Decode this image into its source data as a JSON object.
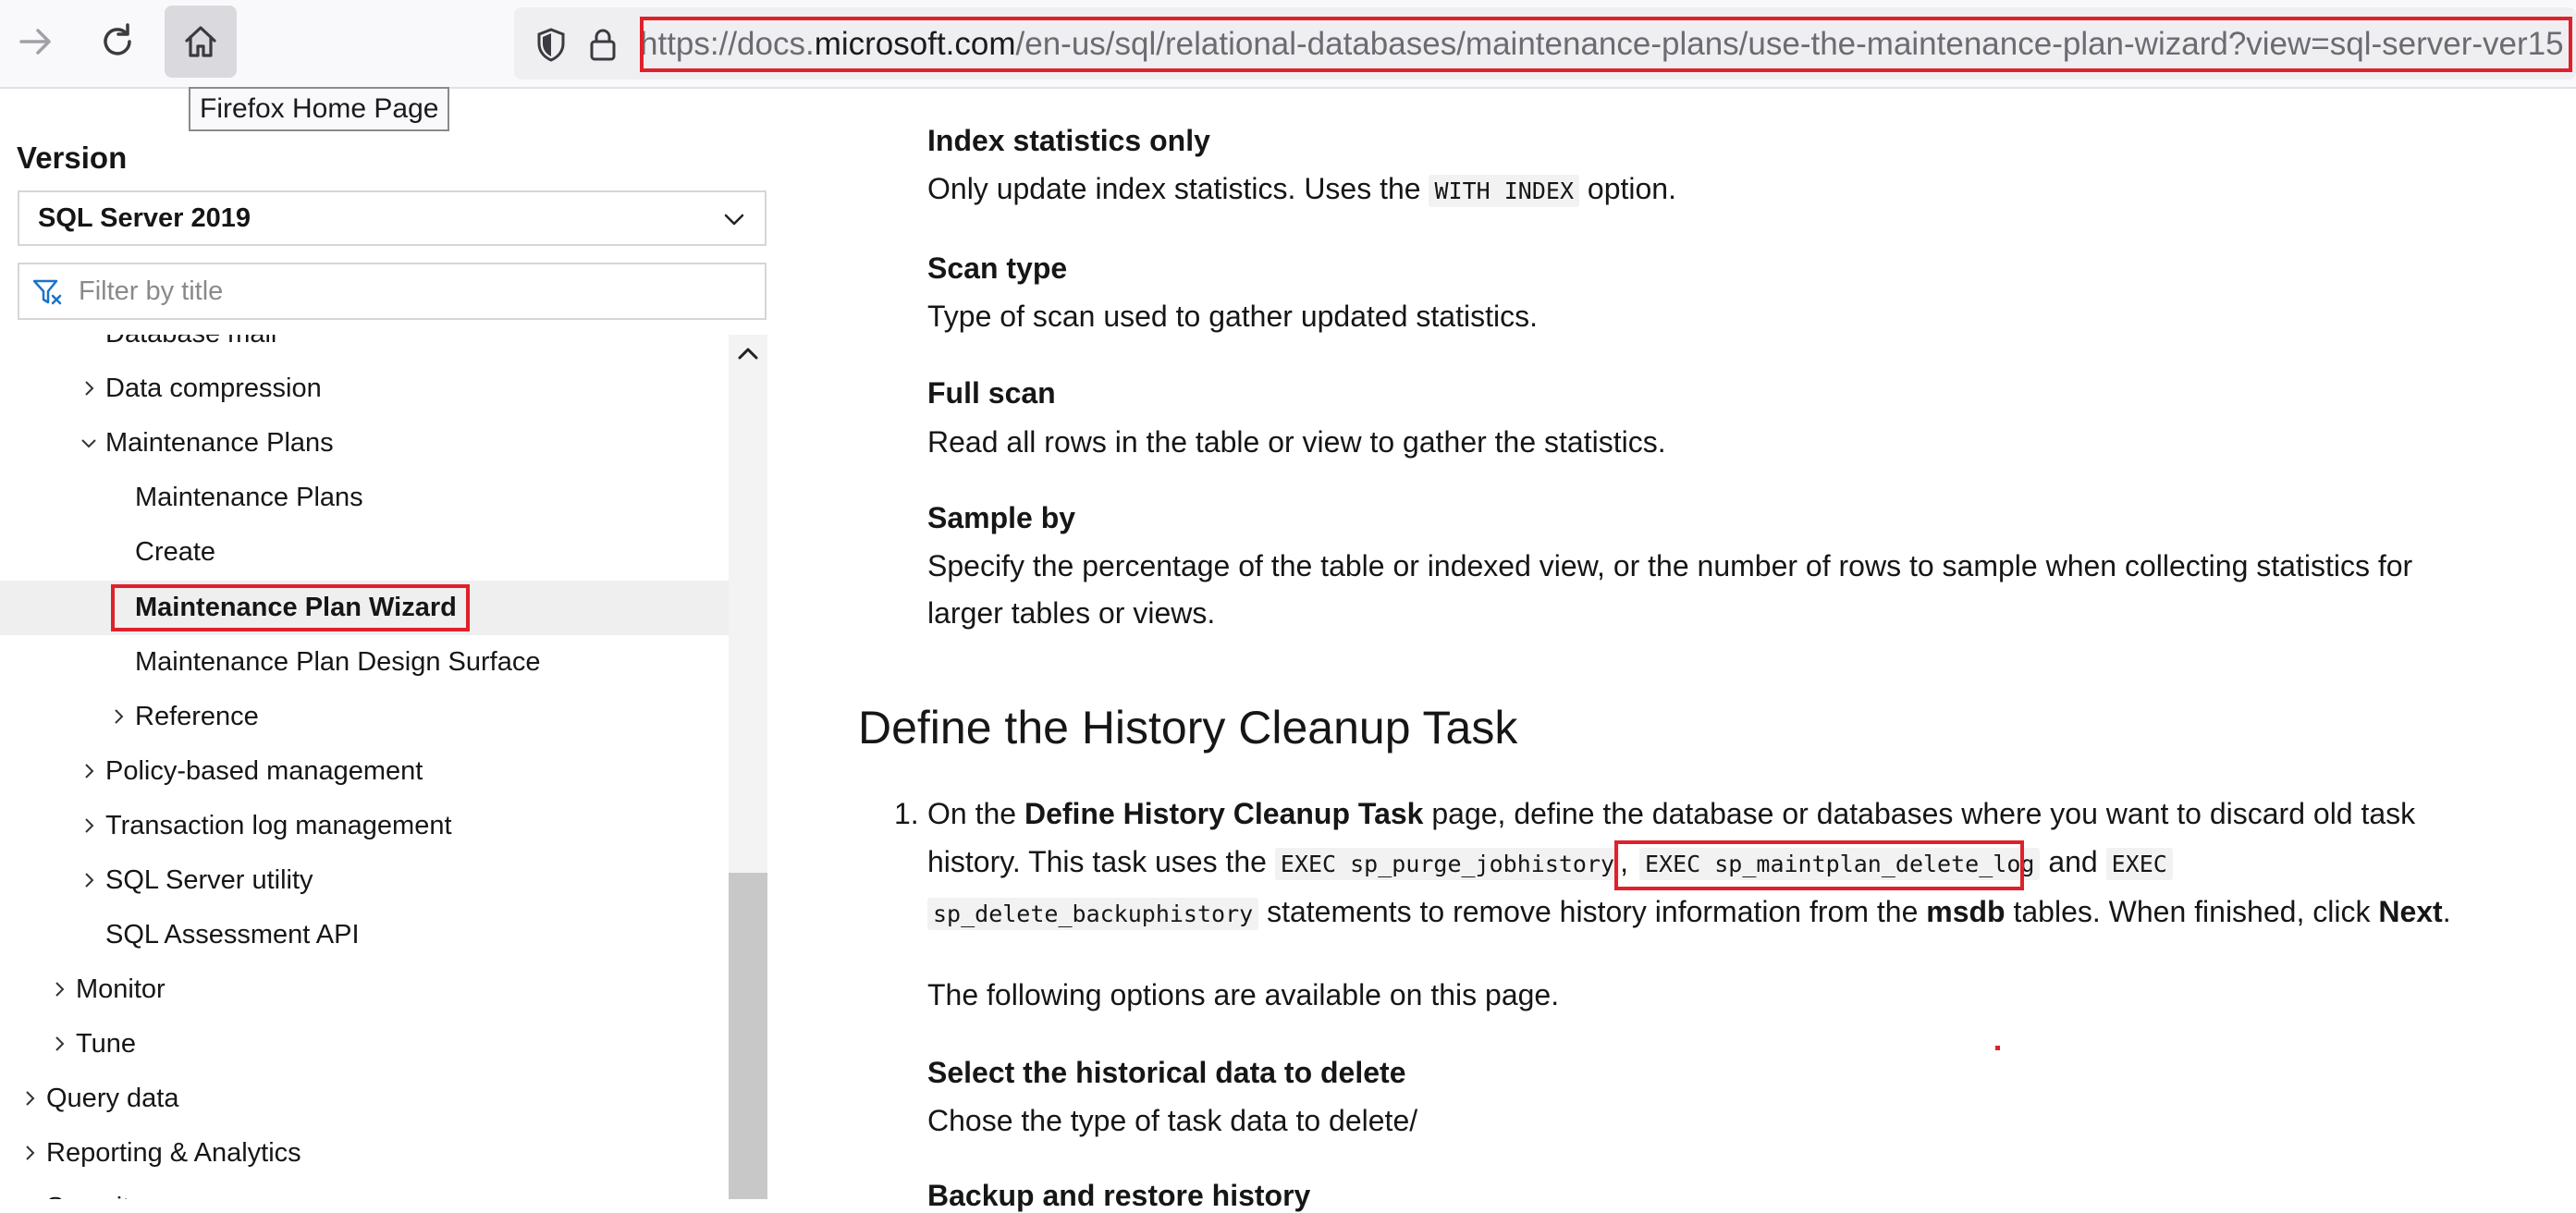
{
  "browser": {
    "url_prefix": "https://docs.",
    "url_host": "microsoft.com",
    "url_path": "/en-us/sql/relational-databases/maintenance-plans/use-the-maintenance-plan-wizard?view=sql-server-ver15",
    "tooltip": "Firefox Home Page"
  },
  "sidebar": {
    "version_label": "Version",
    "version_value": "SQL Server 2019",
    "filter_placeholder": "Filter by title",
    "items": [
      {
        "label": "Database mail"
      },
      {
        "label": "Data compression"
      },
      {
        "label": "Maintenance Plans"
      },
      {
        "label": "Maintenance Plans"
      },
      {
        "label": "Create"
      },
      {
        "label": "Maintenance Plan Wizard"
      },
      {
        "label": "Maintenance Plan Design Surface"
      },
      {
        "label": "Reference"
      },
      {
        "label": "Policy-based management"
      },
      {
        "label": "Transaction log management"
      },
      {
        "label": "SQL Server utility"
      },
      {
        "label": "SQL Assessment API"
      },
      {
        "label": "Monitor"
      },
      {
        "label": "Tune"
      },
      {
        "label": "Query data"
      },
      {
        "label": "Reporting & Analytics"
      },
      {
        "label": "Security"
      }
    ]
  },
  "content": {
    "index_stats_title": "Index statistics only",
    "index_stats_pre": "Only update index statistics. Uses the ",
    "index_stats_code": "WITH INDEX",
    "index_stats_post": " option.",
    "scan_type_title": "Scan type",
    "scan_type_desc": "Type of scan used to gather updated statistics.",
    "full_scan_title": "Full scan",
    "full_scan_desc": "Read all rows in the table or view to gather the statistics.",
    "sample_by_title": "Sample by",
    "sample_by_desc_1": "Specify the percentage of the table or indexed view, or the number of rows to sample when collecting statistics for",
    "sample_by_desc_2": "larger tables or views.",
    "section_heading": "Define the History Cleanup Task",
    "list_number": "1.",
    "step_on_the": "On the ",
    "step_page_name": "Define History Cleanup Task",
    "step_rest_1": " page, define the database or databases where you want to discard old task",
    "step_history": "history. This task uses the ",
    "step_code_1": "EXEC sp_purge_jobhistory",
    "step_comma": ",",
    "step_code_2": "EXEC sp_maintplan_delete_log",
    "step_and": " and ",
    "step_code_3a": "EXEC",
    "step_code_3b": "sp_delete_backuphistory",
    "step_statements": " statements to remove history information from the ",
    "step_msdb": "msdb",
    "step_tables": " tables. When finished, click ",
    "step_next": "Next",
    "step_period": ".",
    "options_intro": "The following options are available on this page.",
    "select_hist_title": "Select the historical data to delete",
    "select_hist_desc": "Chose the type of task data to delete/",
    "backup_restore_title": "Backup and restore history"
  }
}
